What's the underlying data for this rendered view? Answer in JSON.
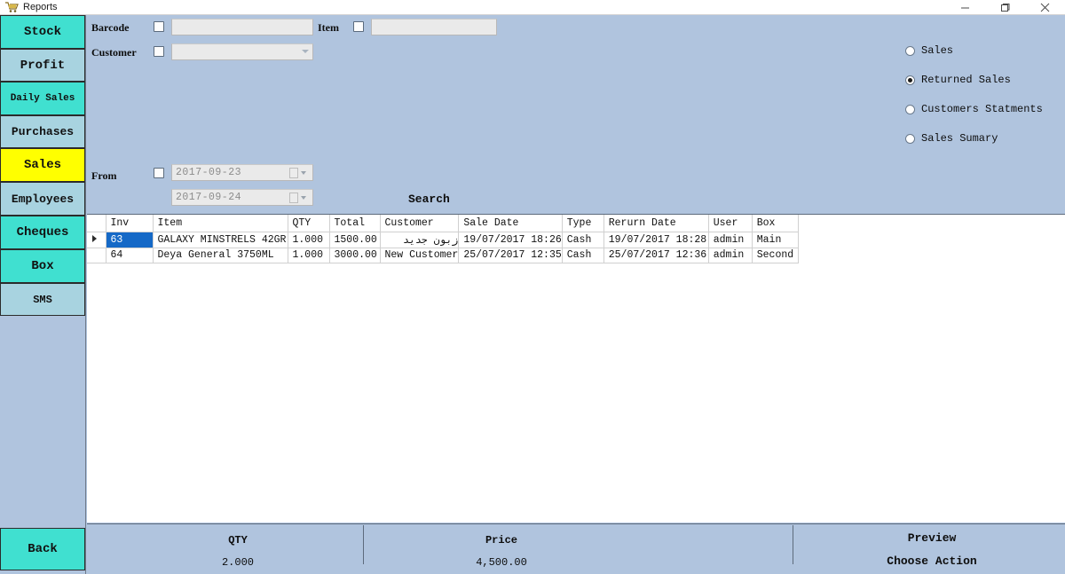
{
  "window": {
    "title": "Reports",
    "icon": "cart-icon",
    "controls": {
      "minimize": "minimize-icon",
      "maximize": "maximize-icon",
      "close": "close-icon"
    }
  },
  "sidebar": {
    "items": [
      {
        "label": "Stock",
        "color": "#40e0d0",
        "state": "normal"
      },
      {
        "label": "Profit",
        "color": "#a8d3e0",
        "state": "normal"
      },
      {
        "label": "Daily Sales",
        "color": "#40e0d0",
        "state": "normal"
      },
      {
        "label": "Purchases",
        "color": "#a8d3e0",
        "state": "normal"
      },
      {
        "label": "Sales",
        "color": "#ffff00",
        "state": "active"
      },
      {
        "label": "Employees",
        "color": "#a8d3e0",
        "state": "normal"
      },
      {
        "label": "Cheques",
        "color": "#40e0d0",
        "state": "normal"
      },
      {
        "label": "Box",
        "color": "#40e0d0",
        "state": "normal"
      },
      {
        "label": "SMS",
        "color": "#a8d3e0",
        "state": "normal"
      }
    ],
    "back_label": "Back",
    "back_color": "#40e0d0"
  },
  "filters": {
    "barcode_label": "Barcode",
    "barcode_value": "",
    "barcode_checked": false,
    "item_label": "Item",
    "item_value": "",
    "item_checked": false,
    "customer_label": "Customer",
    "customer_value": "",
    "customer_checked": false,
    "from_label": "From",
    "from_checked": false,
    "date_from": "2017-09-23",
    "date_to": "2017-09-24",
    "search_label": "Search"
  },
  "report_type": {
    "options": [
      {
        "label": "Sales",
        "selected": false
      },
      {
        "label": "Returned Sales",
        "selected": true
      },
      {
        "label": "Customers Statments",
        "selected": false
      },
      {
        "label": "Sales Sumary",
        "selected": false
      }
    ]
  },
  "grid": {
    "columns": [
      "Inv",
      "Item",
      "QTY",
      "Total",
      "Customer",
      "Sale Date",
      "Type",
      "Rerurn Date",
      "User",
      "Box"
    ],
    "rows": [
      {
        "selected": true,
        "current": true,
        "cells": [
          "63",
          "GALAXY MINSTRELS 42GR",
          "1.000",
          "1500.00",
          "زبون جديد",
          "19/07/2017 18:26",
          "Cash",
          "19/07/2017 18:28",
          "admin",
          "Main"
        ]
      },
      {
        "selected": false,
        "current": false,
        "cells": [
          "64",
          "Deya General 3750ML",
          "1.000",
          "3000.00",
          "New Customer",
          "25/07/2017 12:35",
          "Cash",
          "25/07/2017 12:36",
          "admin",
          "Second"
        ]
      }
    ]
  },
  "footer": {
    "qty_label": "QTY",
    "qty_value": "2.000",
    "price_label": "Price",
    "price_value": "4,500.00",
    "preview_label": "Preview",
    "choose_action_label": "Choose Action"
  },
  "colors": {
    "app_background": "#b0c4de",
    "teal": "#40e0d0",
    "light_blue": "#a8d3e0",
    "yellow": "#ffff00",
    "selection_blue": "#1569c7",
    "grid_background": "#ffffff"
  }
}
